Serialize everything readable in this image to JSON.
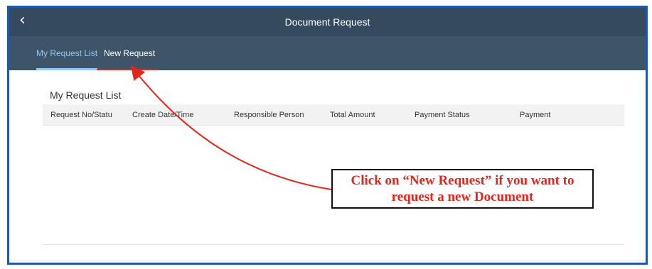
{
  "header": {
    "back_icon": "chevron-left-icon",
    "back_glyph": "‹",
    "title": "Document Request"
  },
  "tabs": [
    {
      "label": "My Request List",
      "selected": true
    },
    {
      "label": "New Request",
      "selected": false
    }
  ],
  "main": {
    "section_title": "My Request List",
    "columns": [
      "Request No/Statu",
      "Create Date/Time",
      "Responsible Person",
      "Total Amount",
      "Payment Status",
      "Payment"
    ],
    "rows": []
  },
  "annotation": {
    "line1": "Click on “New Request” if you want to",
    "line2": "request a new Document",
    "color": "#e3261b"
  },
  "colors": {
    "shell": "#354a5f",
    "tab_bar": "#3e5467",
    "selected_tab": "#91c8f6",
    "frame_border": "#1e5aa8"
  }
}
